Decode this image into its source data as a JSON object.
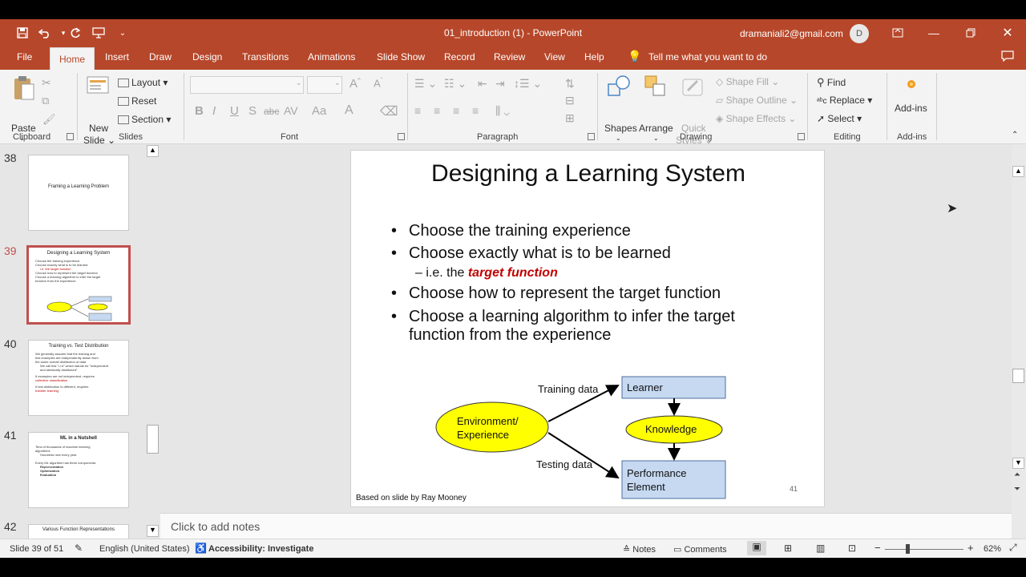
{
  "window": {
    "title": "01_introduction (1)  -  PowerPoint",
    "user_email": "dramaniali2@gmail.com",
    "user_initial": "D"
  },
  "tabs": [
    "File",
    "Home",
    "Insert",
    "Draw",
    "Design",
    "Transitions",
    "Animations",
    "Slide Show",
    "Record",
    "Review",
    "View",
    "Help"
  ],
  "tell_me": "Tell me what you want to do",
  "ribbon": {
    "clipboard": {
      "paste": "Paste",
      "label": "Clipboard"
    },
    "slides": {
      "new_slide_1": "New",
      "new_slide_2": "Slide",
      "layout": "Layout",
      "reset": "Reset",
      "section": "Section",
      "label": "Slides"
    },
    "font": {
      "label": "Font",
      "bold": "B",
      "italic": "I",
      "underline": "U",
      "strike": "S",
      "abc": "abc",
      "av": "AV",
      "aa": "Aa",
      "a": "A"
    },
    "paragraph": {
      "label": "Paragraph"
    },
    "drawing": {
      "shapes": "Shapes",
      "arrange": "Arrange",
      "quick1": "Quick",
      "quick2": "Styles",
      "shape_fill": "Shape Fill",
      "shape_outline": "Shape Outline",
      "shape_effects": "Shape Effects",
      "label": "Drawing"
    },
    "editing": {
      "find": "Find",
      "replace": "Replace",
      "select": "Select",
      "label": "Editing"
    },
    "addins": {
      "addins": "Add-ins",
      "label": "Add-ins"
    }
  },
  "thumbnails": [
    {
      "num": "38",
      "title": "Framing a Learning Problem"
    },
    {
      "num": "39",
      "title": "Designing a Learning System",
      "lines": [
        "Choose the training experience",
        "Choose exactly what is to be learned",
        "i.e. the target function",
        "Choose how to represent the target function",
        "Choose a learning algorithm to infer the target",
        "function from the experience"
      ]
    },
    {
      "num": "40",
      "title": "Training vs. Test Distribution",
      "lines": [
        "We generally assume that the training and",
        "test examples are independently drawn from",
        "the same overall distribution of data",
        "We call this \"i.i.d\" which stands for \"independent",
        "and identically distributed\"",
        "If examples are not independent, requires",
        "collective classification",
        "If test distribution is different, requires",
        "transfer learning"
      ]
    },
    {
      "num": "41",
      "title": "ML in a Nutshell",
      "lines": [
        "Tens of thousands of machine learning",
        "algorithms",
        "Hundreds new every year",
        "Every ML algorithm has three components:",
        "Representation",
        "Optimization",
        "Evaluation"
      ]
    },
    {
      "num": "42",
      "title": "Various Function Representations"
    }
  ],
  "slide": {
    "title": "Designing a Learning System",
    "bullets": [
      "Choose the training experience",
      "Choose exactly what is to be learned",
      "Choose how to represent the target function",
      "Choose a learning algorithm to infer the target function from the experience"
    ],
    "sub_prefix": "i.e. the ",
    "sub_emph": "target function",
    "diagram": {
      "environment_1": "Environment/",
      "environment_2": "Experience",
      "training_data": "Training data",
      "testing_data": "Testing data",
      "learner": "Learner",
      "knowledge": "Knowledge",
      "performance_1": "Performance",
      "performance_2": "Element"
    },
    "footer": "Based on slide by Ray Mooney",
    "page_number": "41"
  },
  "notes_placeholder": "Click to add notes",
  "status": {
    "slide_counter": "Slide 39 of 51",
    "language": "English (United States)",
    "accessibility": "Accessibility: Investigate",
    "notes": "Notes",
    "comments": "Comments",
    "zoom": "62%"
  },
  "colors": {
    "accent": "#b7472a",
    "emph": "#c00000",
    "ellipse": "#ffff00",
    "box": "#c6d9f1"
  }
}
